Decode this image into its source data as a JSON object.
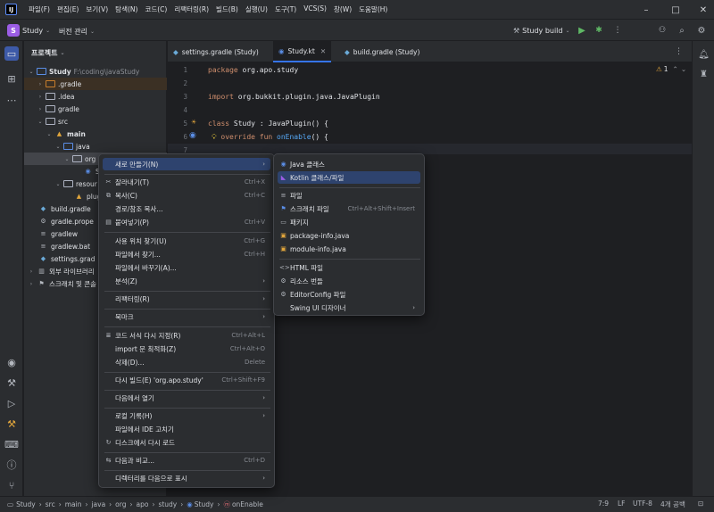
{
  "titlebar": {
    "menu": [
      "파일(F)",
      "편집(E)",
      "보기(V)",
      "탐색(N)",
      "코드(C)",
      "리팩터링(R)",
      "빌드(B)",
      "실행(U)",
      "도구(T)",
      "VCS(S)",
      "창(W)",
      "도움말(H)"
    ]
  },
  "toolbar": {
    "project_badge": "S",
    "project_name": "Study",
    "vcs_label": "버전 관리",
    "run_config": "Study build"
  },
  "project_panel": {
    "title": "프로젝트",
    "tree": [
      {
        "label": "Study",
        "dim": "F:\\coding\\javaStudy"
      },
      {
        "label": ".gradle"
      },
      {
        "label": ".idea"
      },
      {
        "label": "gradle"
      },
      {
        "label": "src"
      },
      {
        "label": "main"
      },
      {
        "label": "java"
      },
      {
        "label": "org"
      },
      {
        "label": "S"
      },
      {
        "label": "resour"
      },
      {
        "label": "plug"
      },
      {
        "label": "build.gradle"
      },
      {
        "label": "gradle.prope"
      },
      {
        "label": "gradlew"
      },
      {
        "label": "gradlew.bat"
      },
      {
        "label": "settings.grad"
      },
      {
        "label": "외부 라이브러리"
      },
      {
        "label": "스크래치 및 콘솔"
      }
    ]
  },
  "tabs": [
    {
      "label": "settings.gradle (Study)"
    },
    {
      "label": "Study.kt"
    },
    {
      "label": "build.gradle (Study)"
    }
  ],
  "editor": {
    "line_numbers": [
      "1",
      "2",
      "3",
      "4",
      "5",
      "6",
      "7"
    ],
    "lines": {
      "l1_kw": "package",
      "l1_rest": " org.apo.study",
      "l3_kw": "import",
      "l3_rest": " org.bukkit.plugin.java.JavaPlugin",
      "l5_kw": "class",
      "l5_name": " Study",
      "l5_rest": " : JavaPlugin() {",
      "l6_kw": "override fun",
      "l6_fn": " onEnable",
      "l6_rest": "() {"
    },
    "warnings": "1"
  },
  "context_menu": [
    {
      "label": "새로 만들기(N)",
      "arrow": "›",
      "selected": true
    },
    {
      "label": "잘라내기(T)",
      "shortcut": "Ctrl+X"
    },
    {
      "label": "복사(C)",
      "shortcut": "Ctrl+C"
    },
    {
      "label": "경로/참조 복사..."
    },
    {
      "label": "붙여넣기(P)",
      "shortcut": "Ctrl+V"
    },
    {
      "label": "사용 위치 찾기(U)",
      "shortcut": "Ctrl+G"
    },
    {
      "label": "파일에서 찾기...",
      "shortcut": "Ctrl+H"
    },
    {
      "label": "파일에서 바꾸기(A)..."
    },
    {
      "label": "분석(Z)",
      "arrow": "›"
    },
    {
      "label": "리팩터링(R)",
      "arrow": "›"
    },
    {
      "label": "북마크",
      "arrow": "›"
    },
    {
      "label": "코드 서식 다시 지정(R)",
      "shortcut": "Ctrl+Alt+L"
    },
    {
      "label": "import 문 최적화(Z)",
      "shortcut": "Ctrl+Alt+O"
    },
    {
      "label": "삭제(D)...",
      "shortcut": "Delete"
    },
    {
      "label": "다시 빌드(E) 'org.apo.study'",
      "shortcut": "Ctrl+Shift+F9"
    },
    {
      "label": "다음에서 열기",
      "arrow": "›"
    },
    {
      "label": "로컬 기록(H)",
      "arrow": "›"
    },
    {
      "label": "파일에서 IDE 고치기"
    },
    {
      "label": "디스크에서 다시 로드"
    },
    {
      "label": "다음과 비교...",
      "shortcut": "Ctrl+D"
    },
    {
      "label": "디렉터리를 다음으로 표시",
      "arrow": "›"
    }
  ],
  "submenu": [
    {
      "label": "Java 클래스"
    },
    {
      "label": "Kotlin 클래스/파일",
      "selected": true
    },
    {
      "label": "파일"
    },
    {
      "label": "스크래치 파일",
      "shortcut": "Ctrl+Alt+Shift+Insert"
    },
    {
      "label": "패키지"
    },
    {
      "label": "package-info.java"
    },
    {
      "label": "module-info.java"
    },
    {
      "label": "HTML 파일"
    },
    {
      "label": "리소스 번들"
    },
    {
      "label": "EditorConfig 파일"
    },
    {
      "label": "Swing UI 디자이너",
      "arrow": "›"
    }
  ],
  "statusbar": {
    "breadcrumb": [
      "Study",
      "src",
      "main",
      "java",
      "org",
      "apo",
      "study",
      "Study",
      "onEnable"
    ],
    "position": "7:9",
    "line_sep": "LF",
    "encoding": "UTF-8",
    "indent": "4개 공백"
  }
}
